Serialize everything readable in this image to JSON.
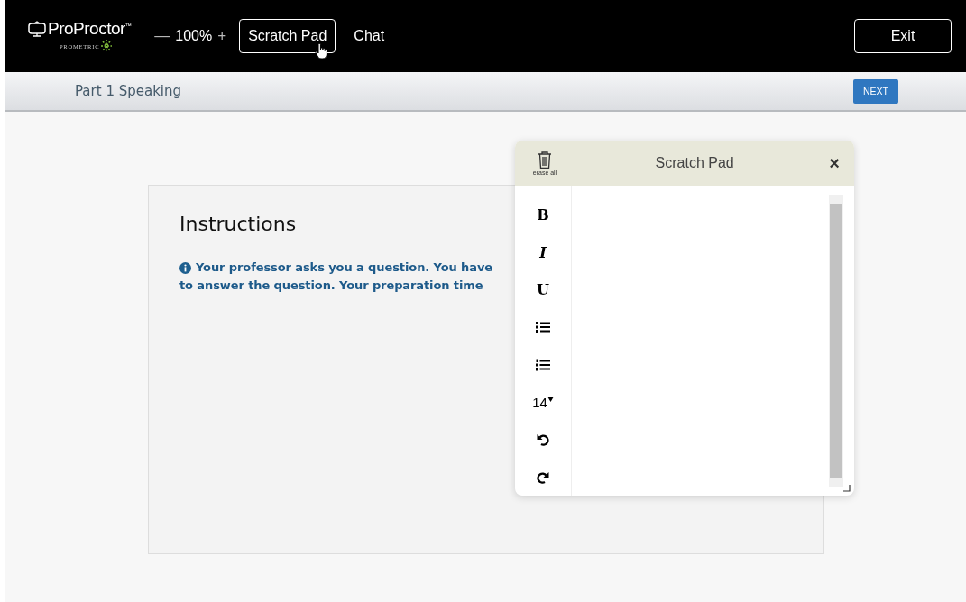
{
  "header": {
    "logo": {
      "name": "ProProctor",
      "tm": "™",
      "sub": "PROMETRIC"
    },
    "zoom": {
      "minus": "—",
      "value": "100%",
      "plus": "+"
    },
    "buttons": [
      {
        "label": "Scratch Pad",
        "selected": true
      },
      {
        "label": "Chat",
        "selected": false
      }
    ],
    "exit": "Exit"
  },
  "subheader": {
    "title": "Part 1 Speaking",
    "next": "NEXT"
  },
  "instructions": {
    "title": "Instructions",
    "lines": [
      "Your professor asks you a question. You have",
      "to answer the question. Your preparation time"
    ]
  },
  "scratch_pad": {
    "title": "Scratch Pad",
    "erase_label": "erase all",
    "close": "×",
    "tools": [
      {
        "kind": "bold",
        "label": "B"
      },
      {
        "kind": "italic",
        "label": "I"
      },
      {
        "kind": "underline",
        "label": "U"
      },
      {
        "kind": "bullet_list"
      },
      {
        "kind": "numbered_list"
      },
      {
        "kind": "font_size",
        "label": "14"
      },
      {
        "kind": "undo"
      },
      {
        "kind": "redo"
      }
    ]
  }
}
